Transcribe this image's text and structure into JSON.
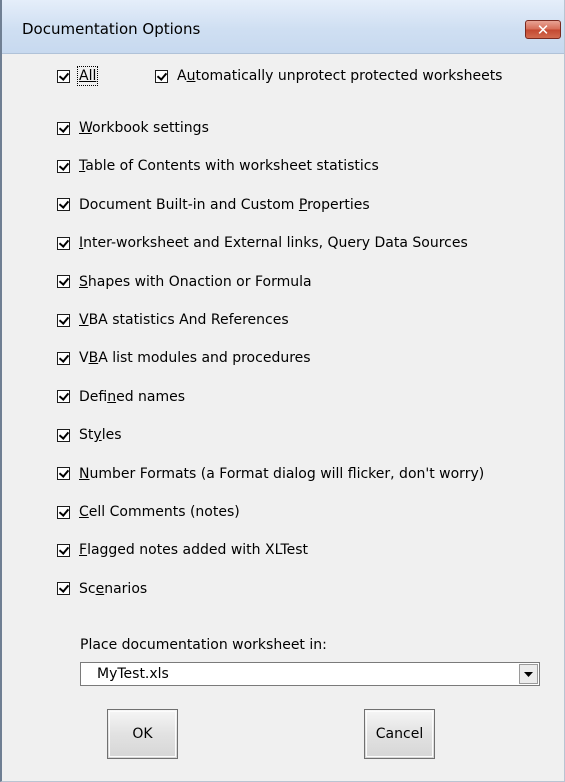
{
  "dialog": {
    "title": "Documentation Options",
    "close_glyph": "✕"
  },
  "options": {
    "all": {
      "label": "All",
      "checked": true
    },
    "auto_unprotect": {
      "pre": "A",
      "key": "u",
      "post": "tomatically unprotect protected worksheets",
      "checked": true
    },
    "items": [
      {
        "pre": "",
        "key": "W",
        "post": "orkbook settings",
        "checked": true
      },
      {
        "pre": "",
        "key": "T",
        "post": "able of Contents with worksheet statistics",
        "checked": true
      },
      {
        "pre": "Document Built-in and Custom ",
        "key": "P",
        "post": "roperties",
        "checked": true
      },
      {
        "pre": "",
        "key": "I",
        "post": "nter-worksheet and External links, Query Data Sources",
        "checked": true
      },
      {
        "pre": "",
        "key": "S",
        "post": "hapes with Onaction or Formula",
        "checked": true
      },
      {
        "pre": "",
        "key": "V",
        "post": "BA statistics And References",
        "checked": true
      },
      {
        "pre": "V",
        "key": "B",
        "post": "A list modules and procedures",
        "checked": true
      },
      {
        "pre": "Defi",
        "key": "n",
        "post": "ed names",
        "checked": true
      },
      {
        "pre": "St",
        "key": "y",
        "post": "les",
        "checked": true
      },
      {
        "pre": "",
        "key": "N",
        "post": "umber Formats (a Format dialog will flicker, don't worry)",
        "checked": true
      },
      {
        "pre": "",
        "key": "C",
        "post": "ell Comments (notes)",
        "checked": true
      },
      {
        "pre": "",
        "key": "F",
        "post": "lagged notes added with XLTest",
        "checked": true
      },
      {
        "pre": "Sc",
        "key": "e",
        "post": "narios",
        "checked": true
      }
    ]
  },
  "placement": {
    "label": "Place documentation worksheet in:",
    "selected": "MyTest.xls"
  },
  "buttons": {
    "ok": "OK",
    "cancel": "Cancel"
  }
}
